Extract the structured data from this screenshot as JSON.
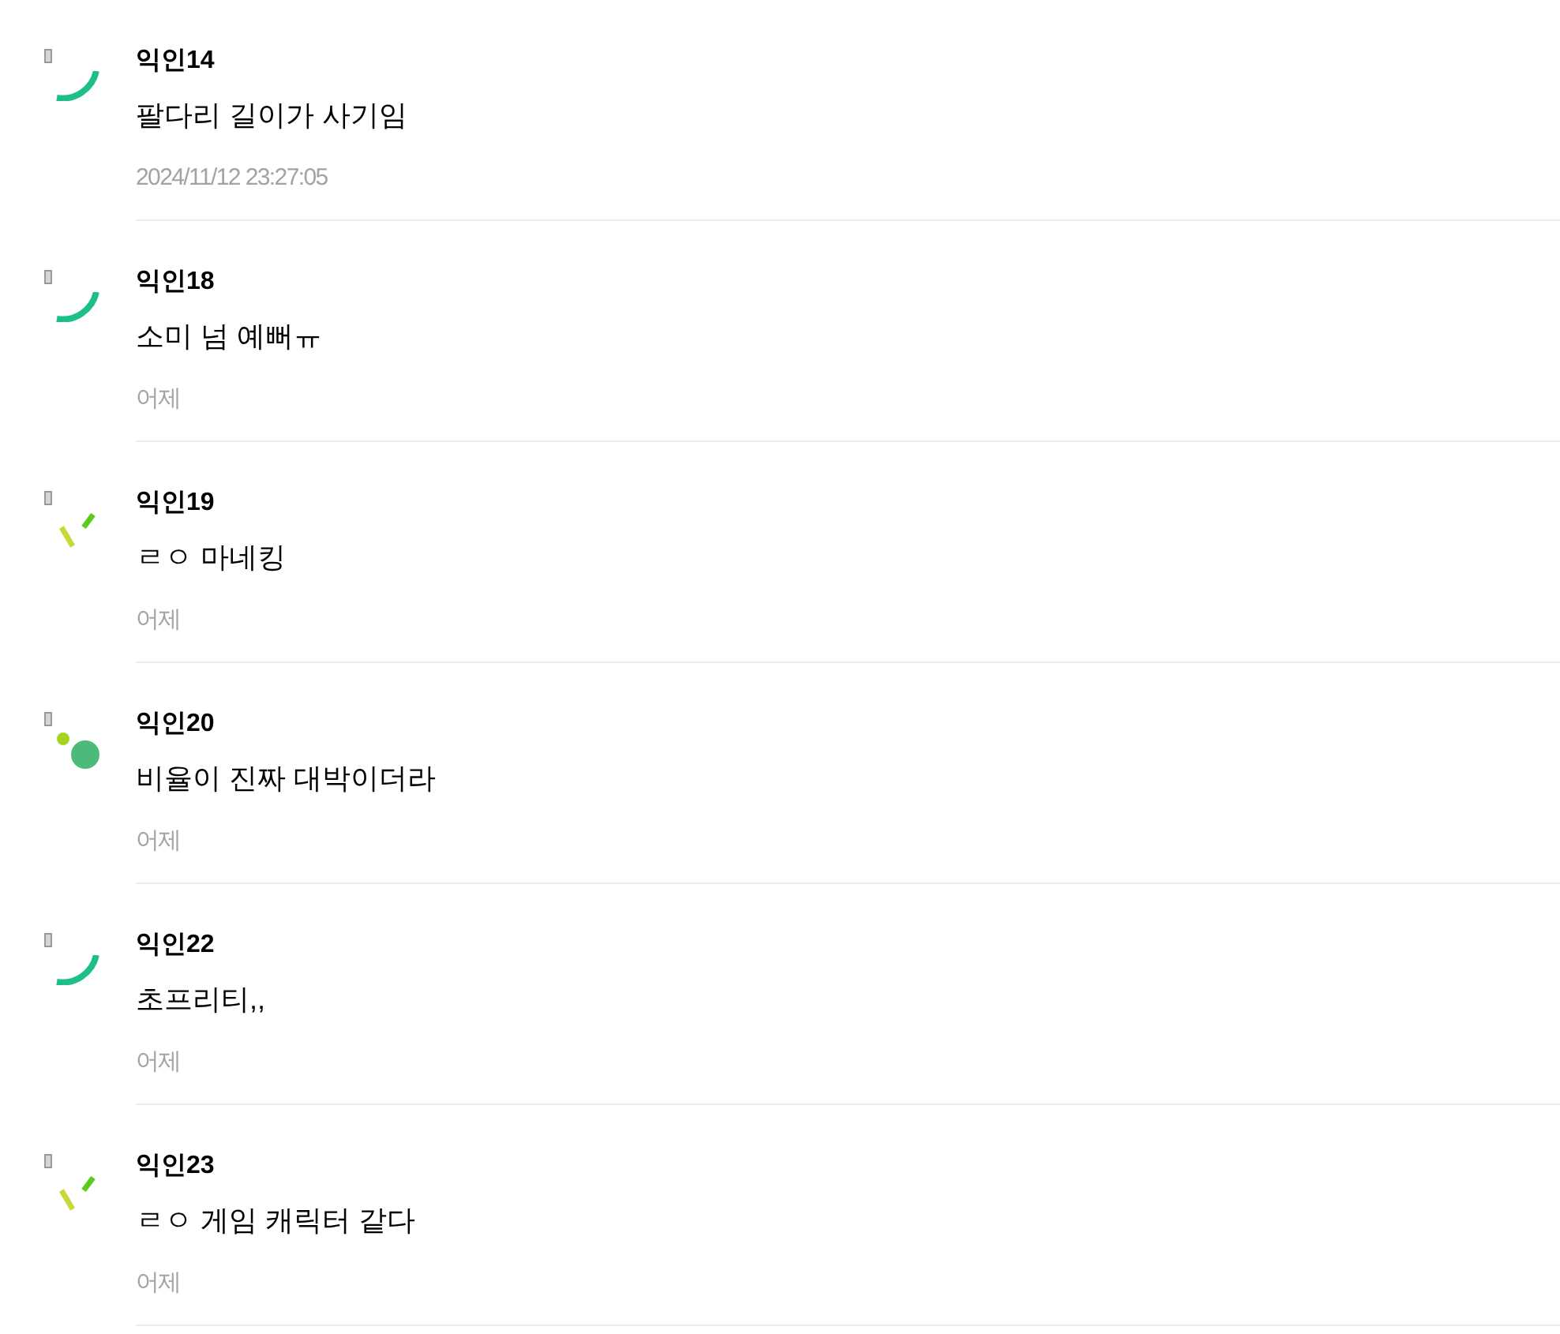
{
  "comments": [
    {
      "author": "익인14",
      "text": "팔다리 길이가 사기임",
      "time": "2024/11/12 23:27:05",
      "avatar": {
        "kind": "arc"
      }
    },
    {
      "author": "익인18",
      "text": "소미 넘 예뻐ㅠ",
      "time": "어제",
      "avatar": {
        "kind": "arc"
      }
    },
    {
      "author": "익인19",
      "text": "ㄹㅇ 마네킹",
      "time": "어제",
      "avatar": {
        "kind": "strokes"
      }
    },
    {
      "author": "익인20",
      "text": "비율이 진짜 대박이더라",
      "time": "어제",
      "avatar": {
        "kind": "dots"
      }
    },
    {
      "author": "익인22",
      "text": "초프리티,,",
      "time": "어제",
      "avatar": {
        "kind": "arc"
      }
    },
    {
      "author": "익인23",
      "text": "ㄹㅇ 게임 캐릭터 같다",
      "time": "어제",
      "avatar": {
        "kind": "strokes"
      }
    }
  ]
}
